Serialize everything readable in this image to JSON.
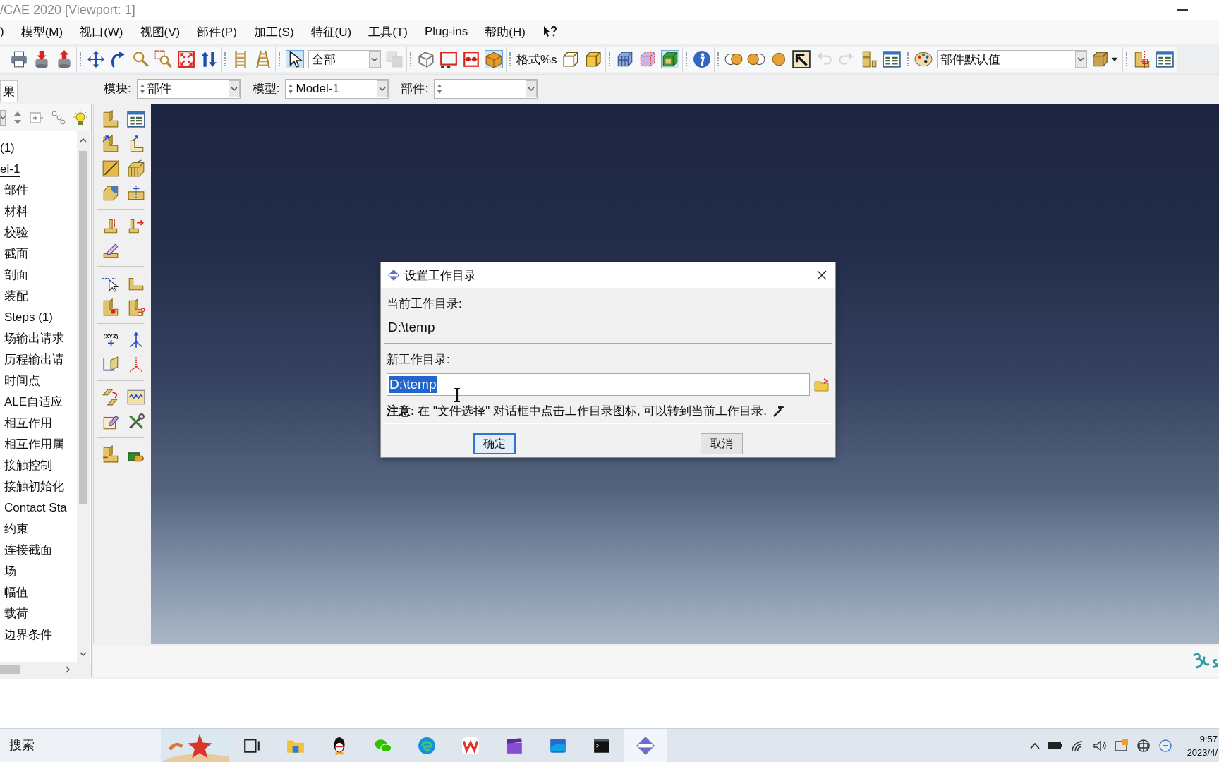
{
  "window": {
    "title": "/CAE 2020 [Viewport: 1]"
  },
  "menu_bar": [
    ")",
    "模型(M)",
    "视口(W)",
    "视图(V)",
    "部件(P)",
    "加工(S)",
    "特征(U)",
    "工具(T)",
    "Plug-ins",
    "帮助(H)"
  ],
  "toolbar": [
    [
      {
        "kind": "button",
        "on": false,
        "disabled": false
      },
      {
        "kind": "button",
        "on": false,
        "disabled": false
      },
      {
        "kind": "button",
        "on": false,
        "disabled": false
      }
    ],
    [
      {
        "kind": "button",
        "on": false,
        "disabled": false
      },
      {
        "kind": "button",
        "on": false,
        "disabled": false
      },
      {
        "kind": "button",
        "on": false,
        "disabled": false
      },
      {
        "kind": "button",
        "on": false,
        "disabled": false
      },
      {
        "kind": "button",
        "on": false,
        "disabled": false
      },
      {
        "kind": "button",
        "on": false,
        "disabled": false
      }
    ],
    [
      {
        "kind": "button",
        "on": false,
        "disabled": false
      },
      {
        "kind": "button",
        "on": false,
        "disabled": false
      }
    ],
    [
      {
        "kind": "button",
        "on": true,
        "disabled": false
      },
      {
        "kind": "combo",
        "value": "全部"
      },
      {
        "kind": "button",
        "on": false,
        "disabled": true
      }
    ],
    [
      {
        "kind": "button",
        "on": false,
        "disabled": false
      },
      {
        "kind": "button",
        "on": false,
        "disabled": false
      },
      {
        "kind": "button",
        "on": false,
        "disabled": false
      },
      {
        "kind": "button",
        "on": true,
        "disabled": false
      }
    ],
    [
      {
        "kind": "label",
        "text": "格式%s"
      },
      {
        "kind": "button",
        "on": false,
        "disabled": false
      },
      {
        "kind": "button",
        "on": false,
        "disabled": false
      }
    ],
    [
      {
        "kind": "button",
        "on": false,
        "disabled": false
      },
      {
        "kind": "button",
        "on": false,
        "disabled": false
      },
      {
        "kind": "button",
        "on": true,
        "disabled": false
      }
    ],
    [
      {
        "kind": "button",
        "on": false,
        "disabled": false
      }
    ],
    [
      {
        "kind": "button",
        "on": false,
        "disabled": false
      },
      {
        "kind": "button",
        "on": false,
        "disabled": false
      },
      {
        "kind": "button",
        "on": false,
        "disabled": false
      },
      {
        "kind": "button",
        "on": false,
        "disabled": false
      },
      {
        "kind": "button",
        "on": false,
        "disabled": true
      },
      {
        "kind": "button",
        "on": false,
        "disabled": true
      },
      {
        "kind": "button",
        "on": false,
        "disabled": false
      },
      {
        "kind": "button",
        "on": false,
        "disabled": false
      }
    ],
    [
      {
        "kind": "button",
        "on": false,
        "disabled": false
      },
      {
        "kind": "combo",
        "value": "部件默认值"
      },
      {
        "kind": "button",
        "on": false,
        "disabled": false
      }
    ],
    [
      {
        "kind": "button",
        "on": false,
        "disabled": false
      },
      {
        "kind": "button",
        "on": false,
        "disabled": false
      }
    ]
  ],
  "context_bar": {
    "tab": "果",
    "fields": [
      {
        "label": "模块:",
        "value": "部件"
      },
      {
        "label": "模型:",
        "value": "Model-1"
      },
      {
        "label": "部件:"
      }
    ]
  },
  "model_tree": [
    {
      "label": "(1)",
      "current": false,
      "children": [
        {
          "label": "el-1",
          "current": true,
          "children": [
            {
              "label": "部件",
              "current": false
            },
            {
              "label": "材料",
              "current": false
            },
            {
              "label": "校验",
              "current": false
            },
            {
              "label": "截面",
              "current": false
            },
            {
              "label": "剖面",
              "current": false
            },
            {
              "label": "装配",
              "current": false
            },
            {
              "label": "Steps (1)",
              "current": false
            },
            {
              "label": "场输出请求",
              "current": false
            },
            {
              "label": "历程输出请",
              "current": false
            },
            {
              "label": "时间点",
              "current": false
            },
            {
              "label": "ALE自适应",
              "current": false
            },
            {
              "label": "相互作用",
              "current": false
            },
            {
              "label": "相互作用属",
              "current": false
            },
            {
              "label": "接触控制",
              "current": false
            },
            {
              "label": "接触初始化",
              "current": false
            },
            {
              "label": "Contact Sta",
              "current": false
            },
            {
              "label": "约束",
              "current": false
            },
            {
              "label": "连接截面",
              "current": false
            },
            {
              "label": "场",
              "current": false
            },
            {
              "label": "幅值",
              "current": false
            },
            {
              "label": "载荷",
              "current": false
            },
            {
              "label": "边界条件",
              "current": false
            }
          ]
        }
      ]
    }
  ],
  "toolbox": {
    "caption": "(XYZ)"
  },
  "dialog": {
    "title": "设置工作目录",
    "current_dir": {
      "label": "当前工作目录:",
      "value": "D:\\temp"
    },
    "new_dir": {
      "label": "新工作目录:",
      "value": "D:\\temp",
      "text_selected": true
    },
    "note": "**注意:** 在 \"文件选择\" 对话框中点击工作目录图标, 可以转到当前工作目录.",
    "buttons": [
      {
        "label": "确定",
        "focused": true
      },
      {
        "label": "取消",
        "focused": false
      }
    ]
  },
  "taskbar": {
    "search": {
      "placeholder": "搜索"
    },
    "apps": [
      {
        "selected": false
      },
      {
        "selected": false
      },
      {
        "selected": false
      },
      {
        "selected": false
      },
      {
        "selected": false
      },
      {
        "selected": false
      },
      {
        "selected": false
      },
      {
        "selected": false
      },
      {
        "selected": false
      },
      {
        "selected": true
      }
    ],
    "clock": {
      "time": "9:57",
      "date": "2023/4/"
    }
  }
}
